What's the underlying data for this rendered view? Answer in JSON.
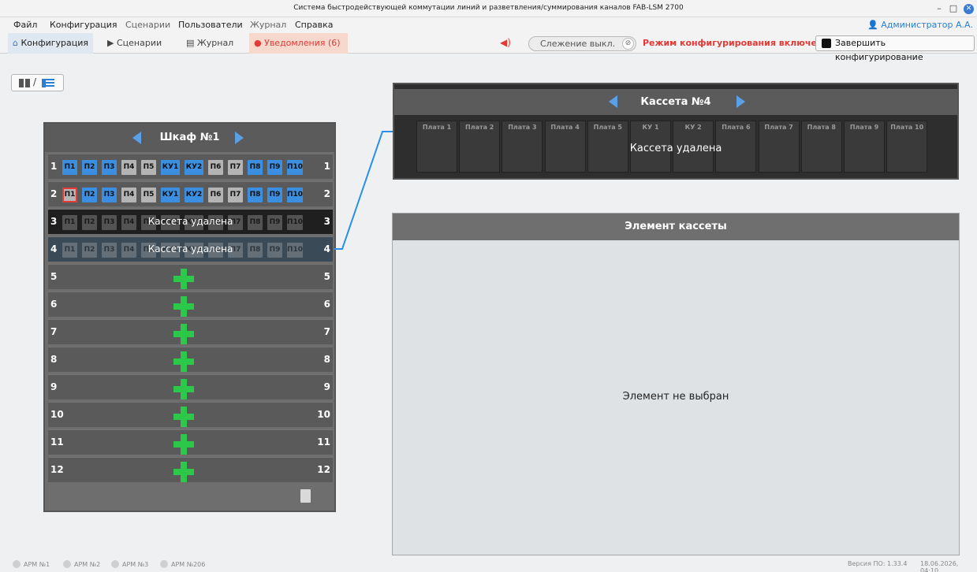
{
  "window": {
    "title": "Система быстродействующей коммутации линий и разветвления/суммирования каналов FAB-LSM 2700"
  },
  "menu": {
    "items": [
      "Файл",
      "Конфигурация",
      "Сценарии",
      "Пользователи",
      "Журнал",
      "Справка"
    ],
    "user": "Администратор А.А."
  },
  "tabs": {
    "config": "Конфигурация",
    "scenarios": "Сценарии",
    "journal": "Журнал",
    "notifications": "Уведомления (6)"
  },
  "toolbar": {
    "tracking": "Слежение выкл.",
    "config_mode": "Режим конфигурирования включен",
    "finish": "Завершить конфигурирование"
  },
  "cabinet": {
    "title": "Шкаф №1",
    "slots": [
      "П1",
      "П2",
      "П3",
      "П4",
      "П5",
      "КУ1",
      "КУ2",
      "П6",
      "П7",
      "П8",
      "П9",
      "П10"
    ],
    "row_numbers": [
      "1",
      "2",
      "3",
      "4",
      "5",
      "6",
      "7",
      "8",
      "9",
      "10",
      "11",
      "12"
    ],
    "removed_text": "Кассета удалена"
  },
  "cassette": {
    "title": "Кассета №4",
    "boards": [
      "Плата 1",
      "Плата 2",
      "Плата 3",
      "Плата 4",
      "Плата 5",
      "КУ 1",
      "КУ 2",
      "Плата 6",
      "Плата 7",
      "Плата 8",
      "Плата 9",
      "Плата 10"
    ],
    "status": "Кассета удалена"
  },
  "element": {
    "title": "Элемент кассеты",
    "empty": "Элемент не выбран"
  },
  "status": {
    "arms": [
      "АРМ №1",
      "АРМ №2",
      "АРМ №3",
      "АРМ №206"
    ],
    "version": "Версия ПО: 1.33.4",
    "datetime": "18.06.2026, 04:10"
  },
  "colors": {
    "accent": "#3c8fe0",
    "alert": "#e53935",
    "add": "#2bc84a"
  }
}
